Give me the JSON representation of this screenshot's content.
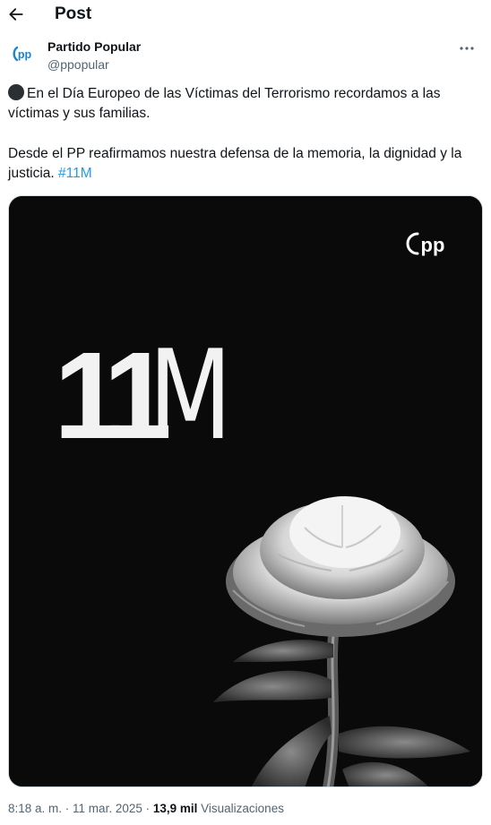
{
  "header": {
    "title": "Post"
  },
  "author": {
    "name": "Partido Popular",
    "handle": "@ppopular"
  },
  "tweet": {
    "line1": "En el Día Europeo de las Víctimas del Terrorismo recordamos a las víctimas y sus familias.",
    "line2": "Desde el PP reafirmamos nuestra defensa de la memoria, la dignidad y la justicia. ",
    "hashtag": "#11M"
  },
  "media": {
    "number_text": "11",
    "letter_text": "M",
    "logo_text": "pp"
  },
  "meta": {
    "time": "8:18 a. m.",
    "sep1": " · ",
    "date": "11 mar. 2025",
    "sep2": " · ",
    "views_count": "13,9 mil",
    "views_label": " Visualizaciones"
  },
  "colors": {
    "accent": "#1d9bf0",
    "brand_blue": "#1d84c8",
    "text_secondary": "#536471"
  }
}
